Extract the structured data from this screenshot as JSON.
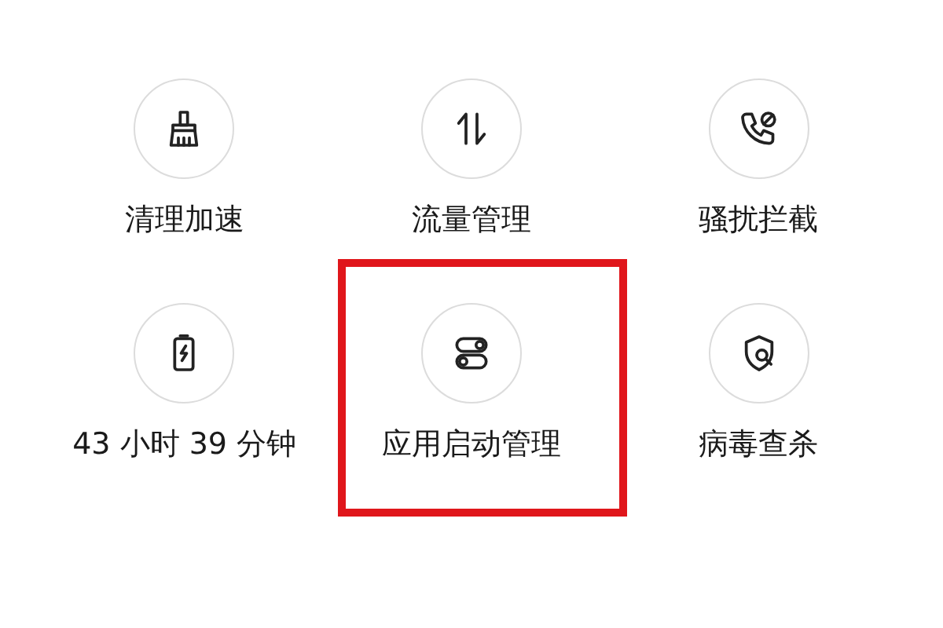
{
  "tools": [
    {
      "label": "清理加速",
      "highlighted": false
    },
    {
      "label": "流量管理",
      "highlighted": false
    },
    {
      "label": "骚扰拦截",
      "highlighted": false
    },
    {
      "label": "43 小时 39 分钟",
      "highlighted": false
    },
    {
      "label": "应用启动管理",
      "highlighted": true
    },
    {
      "label": "病毒查杀",
      "highlighted": false
    }
  ]
}
